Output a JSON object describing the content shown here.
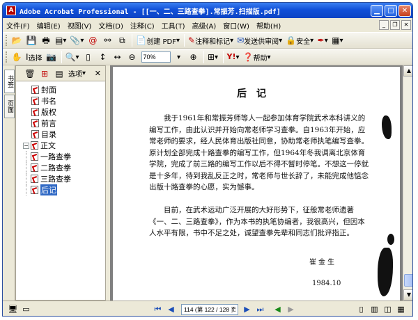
{
  "window": {
    "title": "Adobe Acrobat Professional - [[一、二、三路查拳].常振芳.扫描版.pdf]",
    "app_icon": "acrobat-icon",
    "controls": [
      "minimize",
      "maximize",
      "close"
    ]
  },
  "menubar": {
    "items": [
      "文件(F)",
      "编辑(E)",
      "视图(V)",
      "文档(D)",
      "注释(C)",
      "工具(T)",
      "高级(A)",
      "窗口(W)",
      "帮助(H)"
    ]
  },
  "toolbar1": {
    "create_pdf": "创建 PDF",
    "comment": "注释和标记",
    "send_review": "发送供审阅",
    "secure": "安全"
  },
  "toolbar2": {
    "select": "选择",
    "zoom_value": "70%",
    "help": "帮助"
  },
  "navtabs": [
    "书签",
    "页面"
  ],
  "panel": {
    "options": "选项",
    "bookmarks": [
      {
        "label": "封面",
        "level": 0
      },
      {
        "label": "书名",
        "level": 0
      },
      {
        "label": "版权",
        "level": 0
      },
      {
        "label": "前言",
        "level": 0
      },
      {
        "label": "目录",
        "level": 0
      },
      {
        "label": "正文",
        "level": 0,
        "expanded": true
      },
      {
        "label": "一路查拳",
        "level": 1
      },
      {
        "label": "二路查拳",
        "level": 1
      },
      {
        "label": "三路查拳",
        "level": 1
      },
      {
        "label": "后记",
        "level": 1,
        "selected": true
      }
    ]
  },
  "document": {
    "title": "后记",
    "paragraph1": "我于1961年和常振芳师等人一起参加体育学院武术本科讲义的编写工作，由此认识并开始向常老师学习查拳。自1963年开始，应常老师的要求，经人民体育出版社同意，协助常老师执笔编写查拳。原计划全部完成十路查拳的编写工作，但1964年冬我调离北京体育学院，完成了前三路的编写工作以后不得不暂时停笔。不想这一停就是十多年，待到我乱反正之时，常老师与世长辞了，未能完成他惦念出版十路查拳的心愿，实为憾事。",
    "paragraph2": "目前，在武术运动广泛开展的大好形势下，征般常老师遗著《一、二、三路查拳》，作为本书的执笔协编者，我很高兴，但因本人水平有限，书中不足之处，诚望查拳先辈和同志们批评指正。",
    "signature": "崔金生",
    "date": "1984.10"
  },
  "statusbar": {
    "page_field": "114 (第 122 / 128 页)"
  }
}
